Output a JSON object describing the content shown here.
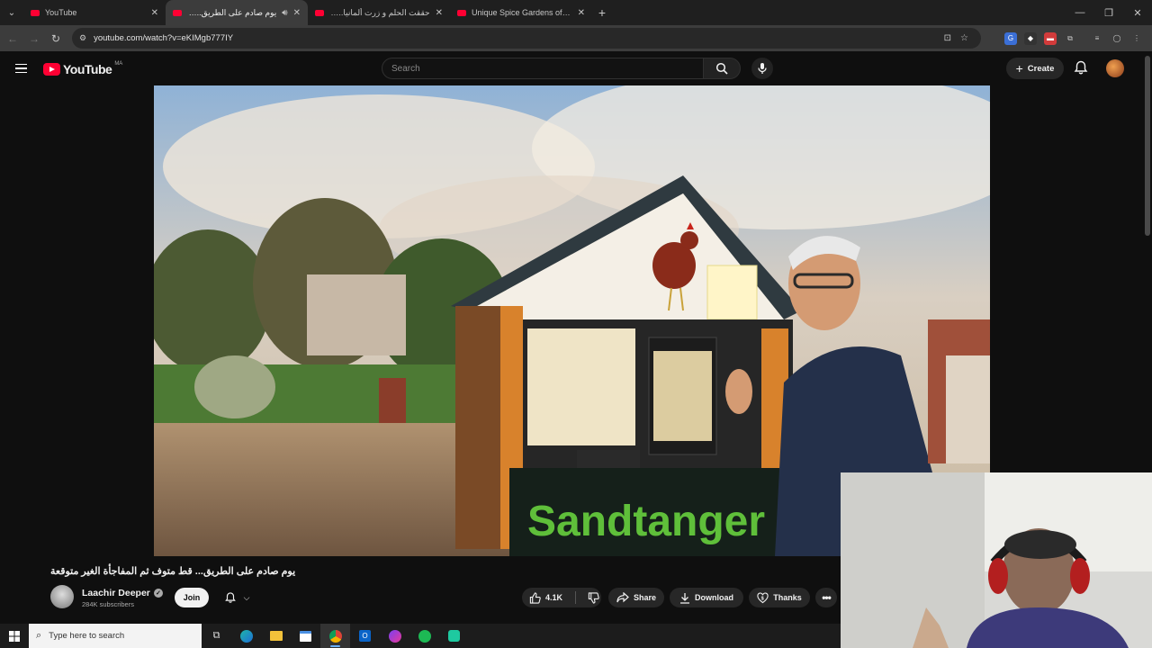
{
  "browser": {
    "tabs": [
      {
        "title": "YouTube"
      },
      {
        "title": "يوم صادم على الطريق... قطـ"
      },
      {
        "title": "حققت الحلم و زرت ألمانيا.. شفت"
      },
      {
        "title": "Unique Spice Gardens of the Vi"
      }
    ],
    "url": "youtube.com/watch?v=eKIMgb777IY"
  },
  "youtube": {
    "logo_text": "YouTube",
    "country_code": "MA",
    "search_placeholder": "Search",
    "create_label": "Create"
  },
  "video": {
    "sign_text": "Sandtanger",
    "title": "يوم صادم على الطريق... قط متوف ثم المفاجأة الغير متوقعة",
    "channel": "Laachir Deeper",
    "subscribers": "284K subscribers",
    "join_label": "Join",
    "likes": "4.1K",
    "share_label": "Share",
    "download_label": "Download",
    "thanks_label": "Thanks"
  },
  "taskbar": {
    "search_placeholder": "Type here to search"
  },
  "colors": {
    "youtube_red": "#ff0033",
    "page_bg": "#0f0f0f",
    "pill_bg": "#272727"
  }
}
